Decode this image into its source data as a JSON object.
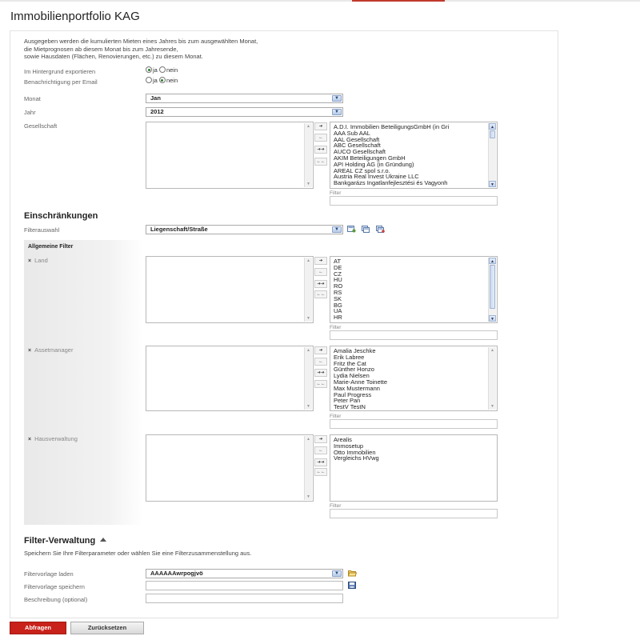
{
  "title": "Immobilienportfolio KAG",
  "intro": {
    "line1": "Ausgegeben werden die kumulierten Mieten eines Jahres bis zum ausgewählten Monat,",
    "line2": "die Mietprognosen ab diesem Monat bis zum Jahresende,",
    "line3": "sowie Hausdaten (Flächen, Renovierungen, etc.) zu diesem Monat."
  },
  "export": {
    "label": "Im Hintergrund exportieren",
    "yes": "ja",
    "no": "nein",
    "selected": "ja"
  },
  "notify": {
    "label": "Benachrichtigung per Email",
    "yes": "ja",
    "no": "nein",
    "selected": "nein"
  },
  "month": {
    "label": "Monat",
    "value": "Jan"
  },
  "year": {
    "label": "Jahr",
    "value": "2012"
  },
  "company": {
    "label": "Gesellschaft",
    "available": [
      "A.D.I. Immobilien BeteiligungsGmbH (in Gri",
      "AAA Sub AAL",
      "AAL Gesellschaft",
      "ABC Gesellschaft",
      "AUCO Gesellschaft",
      "AKIM Beteiligungen GmbH",
      "API Holding AG (in Gründung)",
      "AREAL CZ spol s.r.o.",
      "Austria Real Invest Ukraine LLC",
      "Bankgarázs Ingatlanfejlesztési és Vagyonh"
    ],
    "filter_label": "Filter"
  },
  "move_buttons": {
    "add": "➔",
    "remove": "←",
    "add_all": "➔➔",
    "remove_all": "←←"
  },
  "restrictions": {
    "heading": "Einschränkungen",
    "filter_label": "Filterauswahl",
    "filter_value": "Liegenschaft/Straße",
    "general_heading": "Allgemeine Filter",
    "close_glyph": "×",
    "country": {
      "label": "Land",
      "available": [
        "AT",
        "DE",
        "CZ",
        "HU",
        "RO",
        "RS",
        "SK",
        "BG",
        "UA",
        "HR"
      ],
      "filter_label": "Filter"
    },
    "asset_manager": {
      "label": "Assetmanager",
      "available": [
        "Amalia Jeschke",
        "Erik Labree",
        "Fritz the Cat",
        "Günther Honzo",
        "Lydia Nielsen",
        "Marie-Anne Toinette",
        "Max Mustermann",
        "Paul Progress",
        "Peter Pan",
        "TestV TestN"
      ],
      "filter_label": "Filter"
    },
    "property_mgmt": {
      "label": "Hausverwaltung",
      "available": [
        "Arealis",
        "Immosetup",
        "Otto Immobilien",
        "Vergleichs HVwg"
      ],
      "filter_label": "Filter"
    }
  },
  "filter_mgmt": {
    "heading": "Filter-Verwaltung",
    "description": "Speichern Sie Ihre Filterparameter oder wählen Sie eine Filterzusammenstellung aus.",
    "load_label": "Filtervorlage laden",
    "load_value": "AAAAAAwrpogjvö",
    "save_label": "Filtervorlage speichern",
    "desc_label": "Beschreibung (optional)"
  },
  "buttons": {
    "submit": "Abfragen",
    "reset": "Zurücksetzen"
  },
  "colors": {
    "primary": "#c8221a",
    "accent_line": "#c0392b"
  }
}
